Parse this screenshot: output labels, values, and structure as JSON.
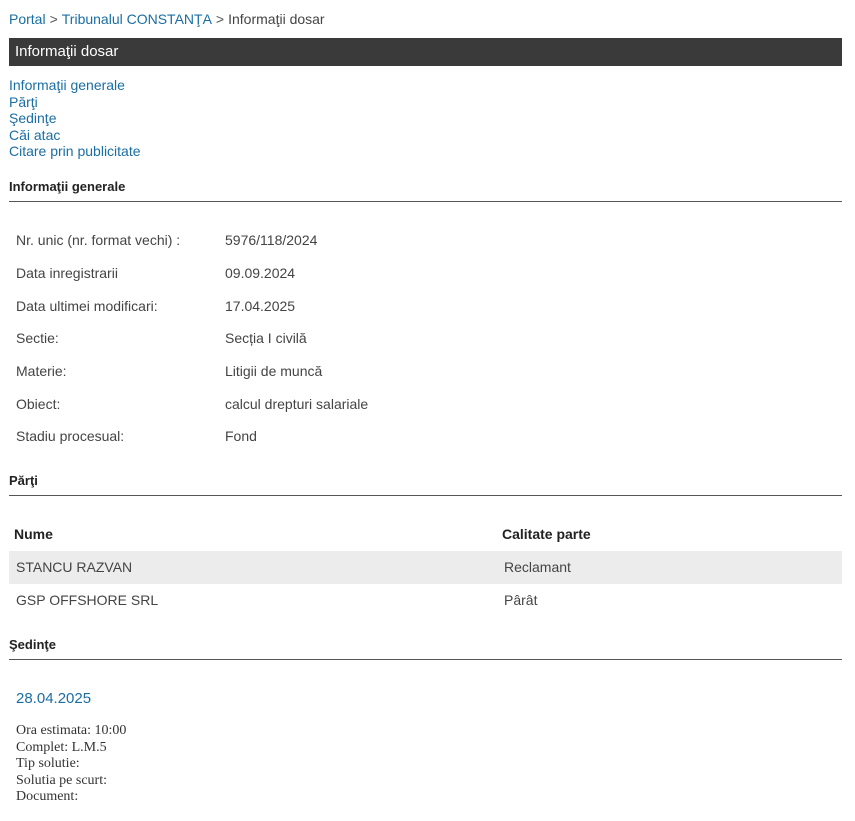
{
  "breadcrumb": {
    "portal": "Portal",
    "court": "Tribunalul CONSTANŢA",
    "current": "Informaţii dosar",
    "separator": ">"
  },
  "titlebar": {
    "title": "Informaţii dosar"
  },
  "nav": {
    "items": [
      "Informaţii generale",
      "Părţi",
      "Şedinţe",
      "Căi atac",
      "Citare prin publicitate"
    ]
  },
  "general": {
    "title": "Informaţii generale",
    "rows": [
      {
        "label": "Nr. unic (nr. format vechi) :",
        "value": "5976/118/2024"
      },
      {
        "label": "Data inregistrarii",
        "value": "09.09.2024"
      },
      {
        "label": "Data ultimei modificari:",
        "value": "17.04.2025"
      },
      {
        "label": "Sectie:",
        "value": "Secția I civilă"
      },
      {
        "label": "Materie:",
        "value": "Litigii de muncă"
      },
      {
        "label": "Obiect:",
        "value": "calcul drepturi salariale"
      },
      {
        "label": "Stadiu procesual:",
        "value": "Fond"
      }
    ]
  },
  "parti": {
    "title": "Părţi",
    "headers": {
      "name": "Nume",
      "role": "Calitate parte"
    },
    "rows": [
      {
        "name": "STANCU RAZVAN",
        "role": "Reclamant"
      },
      {
        "name": "GSP OFFSHORE SRL",
        "role": "Pârât"
      }
    ]
  },
  "sedinte": {
    "title": "Şedinţe",
    "date": "28.04.2025",
    "details": {
      "ora": "Ora estimata: 10:00",
      "complet": "Complet: L.M.5",
      "tip": "Tip solutie:",
      "solutie": "Solutia pe scurt:",
      "document": "Document:"
    }
  },
  "colors": {
    "link": "#1a6ea3",
    "titlebar": "#3a3a3a",
    "row_alt": "#ececec"
  }
}
